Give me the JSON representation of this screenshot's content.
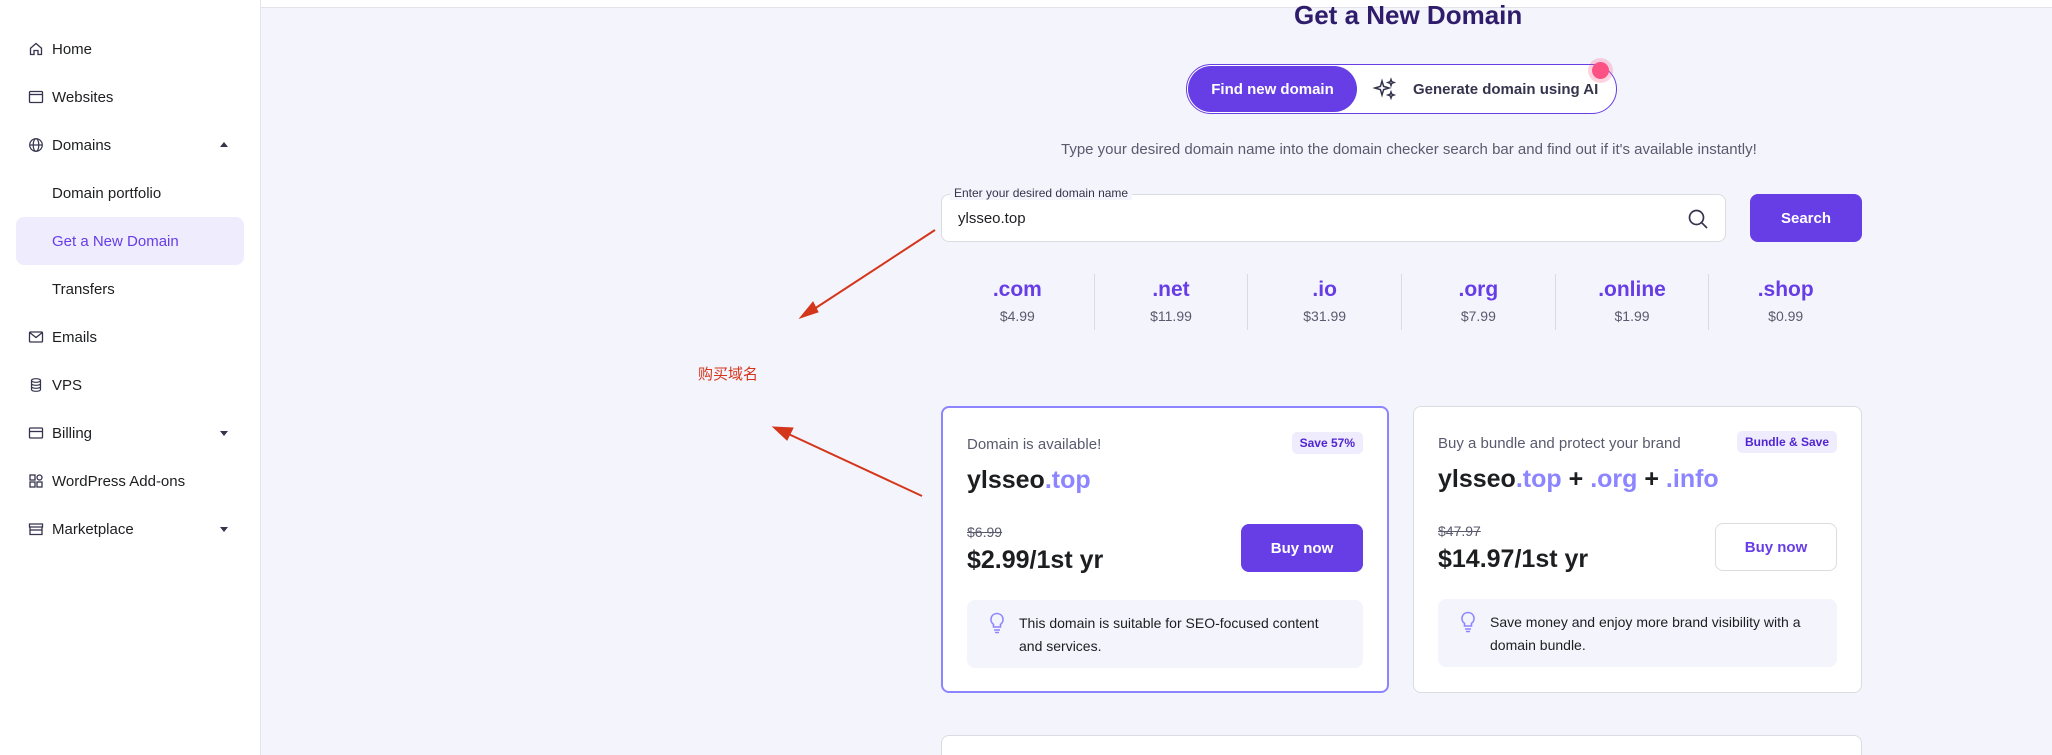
{
  "sidebar": {
    "items": [
      {
        "label": "Home",
        "icon": "home-icon"
      },
      {
        "label": "Websites",
        "icon": "browser-icon"
      },
      {
        "label": "Domains",
        "icon": "globe-icon"
      },
      {
        "label": "Domain portfolio"
      },
      {
        "label": "Get a New Domain"
      },
      {
        "label": "Transfers"
      },
      {
        "label": "Emails",
        "icon": "mail-icon"
      },
      {
        "label": "VPS",
        "icon": "server-icon"
      },
      {
        "label": "Billing",
        "icon": "card-icon"
      },
      {
        "label": "WordPress Add-ons",
        "icon": "addons-icon"
      },
      {
        "label": "Marketplace",
        "icon": "store-icon"
      }
    ]
  },
  "main": {
    "title": "Get a New Domain",
    "toggle": {
      "option1": "Find new domain",
      "option2": "Generate domain using AI"
    },
    "subtitle": "Type your desired domain name into the domain checker search bar and find out if it's available instantly!",
    "search": {
      "label": "Enter your desired domain name",
      "value": "ylsseo.top",
      "button": "Search"
    },
    "tlds": [
      {
        "name": ".com",
        "price": "$4.99"
      },
      {
        "name": ".net",
        "price": "$11.99"
      },
      {
        "name": ".io",
        "price": "$31.99"
      },
      {
        "name": ".org",
        "price": "$7.99"
      },
      {
        "name": ".online",
        "price": "$1.99"
      },
      {
        "name": ".shop",
        "price": "$0.99"
      }
    ],
    "annotation": "购买域名",
    "cards": [
      {
        "head": "Domain is available!",
        "badge": "Save 57%",
        "name_base": "ylsseo",
        "name_ext": ".top",
        "old_price": "$6.99",
        "new_price": "$2.99/1st yr",
        "button": "Buy now",
        "info": "This domain is suitable for SEO-focused content and services."
      },
      {
        "head": "Buy a bundle and protect your brand",
        "badge": "Bundle & Save",
        "name_base": "ylsseo",
        "name_ext1": ".top",
        "plus": "+",
        "name_ext2": ".org",
        "name_ext3": ".info",
        "old_price": "$47.97",
        "new_price": "$14.97/1st yr",
        "button": "Buy now",
        "info": "Save money and enjoy more brand visibility with a domain bundle."
      }
    ]
  },
  "colors": {
    "primary": "#673de6",
    "accent": "#8c85ff",
    "annotation": "#d4361b",
    "notification": "#fc5185"
  }
}
